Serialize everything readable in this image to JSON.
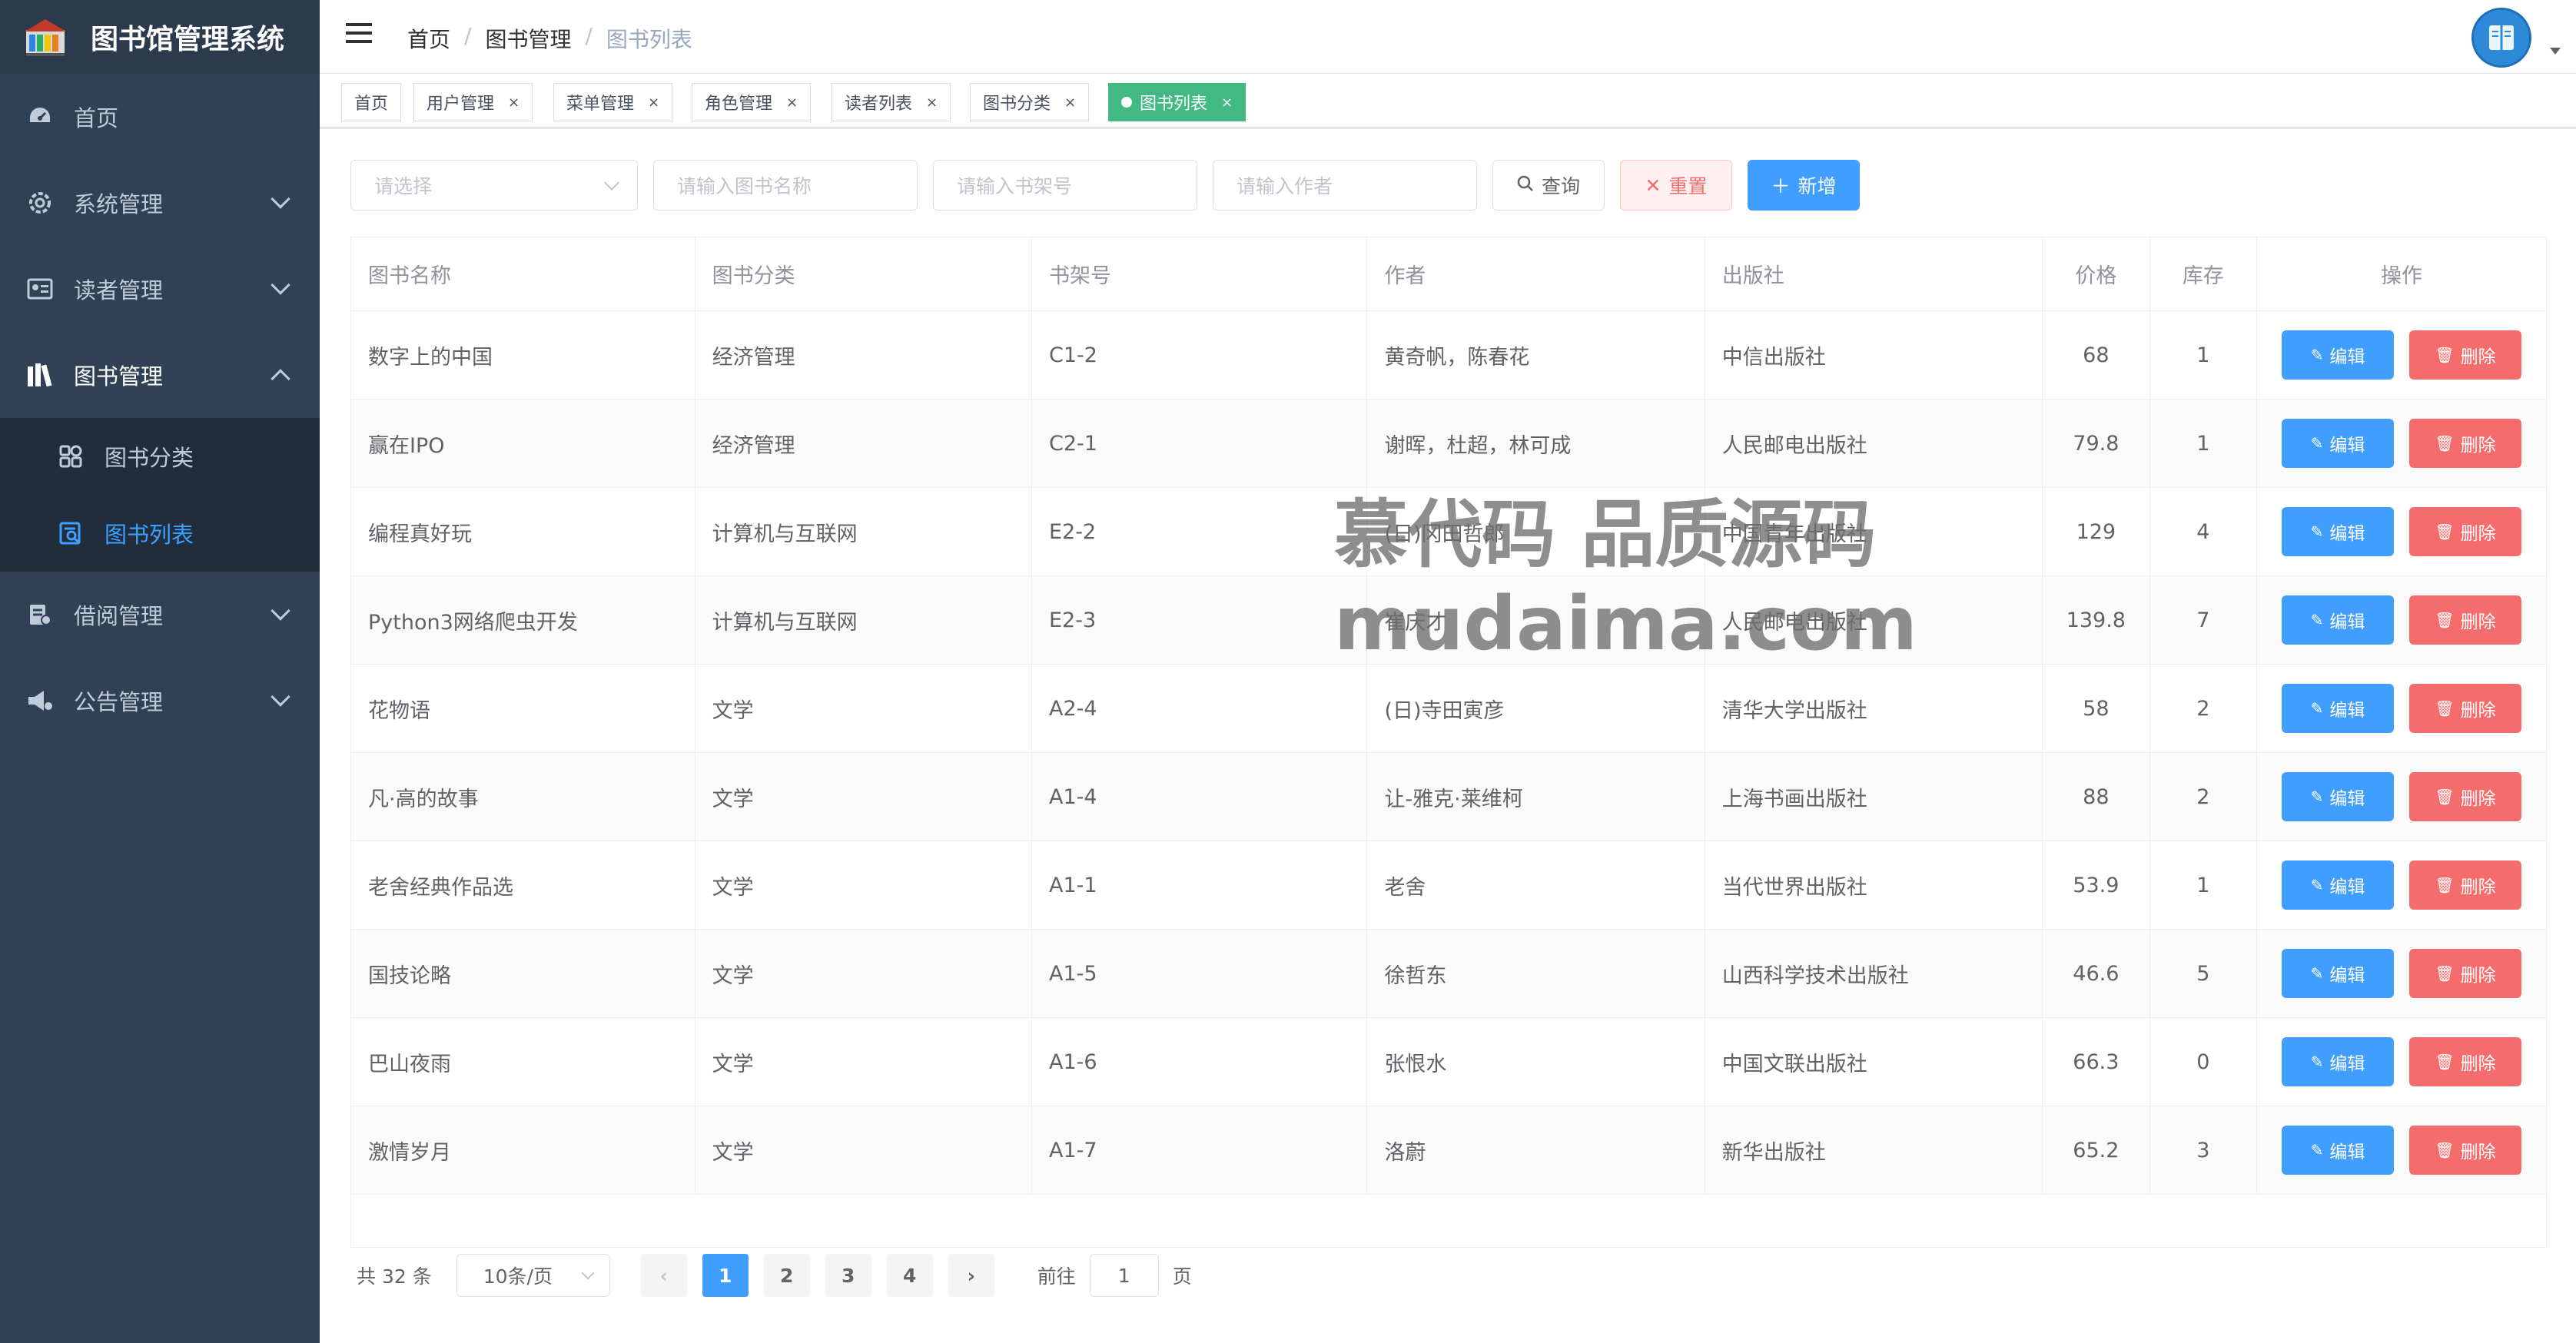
{
  "app": {
    "title": "图书馆管理系统"
  },
  "sidebar": {
    "items": [
      {
        "label": "首页",
        "icon": "dashboard-icon"
      },
      {
        "label": "系统管理",
        "icon": "gear-icon"
      },
      {
        "label": "读者管理",
        "icon": "id-card-icon"
      },
      {
        "label": "图书管理",
        "icon": "books-icon",
        "expanded": true,
        "children": [
          {
            "label": "图书分类",
            "icon": "category-icon"
          },
          {
            "label": "图书列表",
            "icon": "book-list-icon",
            "active": true
          }
        ]
      },
      {
        "label": "借阅管理",
        "icon": "borrow-icon"
      },
      {
        "label": "公告管理",
        "icon": "announcement-icon"
      }
    ]
  },
  "header": {
    "breadcrumb": [
      "首页",
      "图书管理",
      "图书列表"
    ]
  },
  "tags": [
    {
      "label": "首页",
      "closable": false
    },
    {
      "label": "用户管理",
      "closable": true
    },
    {
      "label": "菜单管理",
      "closable": true
    },
    {
      "label": "角色管理",
      "closable": true
    },
    {
      "label": "读者列表",
      "closable": true
    },
    {
      "label": "图书分类",
      "closable": true
    },
    {
      "label": "图书列表",
      "closable": true,
      "active": true
    }
  ],
  "tag_close": "×",
  "filters": {
    "category_placeholder": "请选择",
    "name_placeholder": "请输入图书名称",
    "shelf_placeholder": "请输入书架号",
    "author_placeholder": "请输入作者"
  },
  "buttons": {
    "query": "查询",
    "reset": "重置",
    "add": "新增"
  },
  "table": {
    "headers": [
      "图书名称",
      "图书分类",
      "书架号",
      "作者",
      "出版社",
      "价格",
      "库存",
      "操作"
    ],
    "rows": [
      [
        "数字上的中国",
        "经济管理",
        "C1-2",
        "黄奇帆，陈春花",
        "中信出版社",
        "68",
        "1"
      ],
      [
        "赢在IPO",
        "经济管理",
        "C2-1",
        "谢晖，杜超，林可成",
        "人民邮电出版社",
        "79.8",
        "1"
      ],
      [
        "编程真好玩",
        "计算机与互联网",
        "E2-2",
        "(日)冈田哲郎",
        "中国青年出版社",
        "129",
        "4"
      ],
      [
        "Python3网络爬虫开发",
        "计算机与互联网",
        "E2-3",
        "崔庆才",
        "人民邮电出版社",
        "139.8",
        "7"
      ],
      [
        "花物语",
        "文学",
        "A2-4",
        "(日)寺田寅彦",
        "清华大学出版社",
        "58",
        "2"
      ],
      [
        "凡·高的故事",
        "文学",
        "A1-4",
        "让-雅克·莱维柯",
        "上海书画出版社",
        "88",
        "2"
      ],
      [
        "老舍经典作品选",
        "文学",
        "A1-1",
        "老舍",
        "当代世界出版社",
        "53.9",
        "1"
      ],
      [
        "国技论略",
        "文学",
        "A1-5",
        "徐哲东",
        "山西科学技术出版社",
        "46.6",
        "5"
      ],
      [
        "巴山夜雨",
        "文学",
        "A1-6",
        "张恨水",
        "中国文联出版社",
        "66.3",
        "0"
      ],
      [
        "激情岁月",
        "文学",
        "A1-7",
        "洛蔚",
        "新华出版社",
        "65.2",
        "3"
      ]
    ],
    "edit_label": "编辑",
    "delete_label": "删除"
  },
  "pagination": {
    "total_text": "共 32 条",
    "page_size": "10条/页",
    "pages": [
      "1",
      "2",
      "3",
      "4"
    ],
    "current": "1",
    "goto_prefix": "前往",
    "goto_value": "1",
    "goto_suffix": "页"
  },
  "watermark": {
    "line1": "慕代码 品质源码",
    "line2": "mudaima.com"
  },
  "colors": {
    "sidebar": "#304156",
    "primary": "#409eff",
    "danger": "#f56c6c",
    "tag_active": "#42b983"
  }
}
